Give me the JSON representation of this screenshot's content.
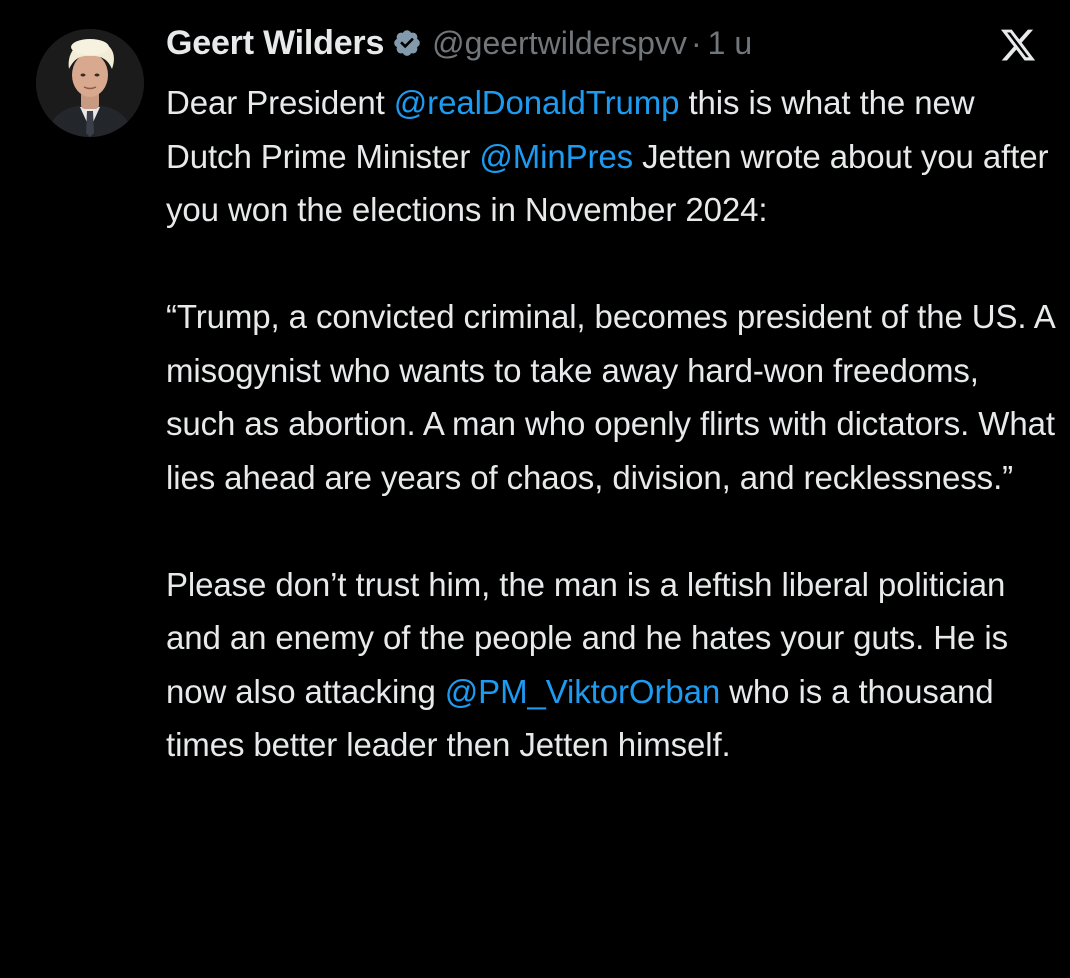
{
  "author": {
    "display_name": "Geert Wilders",
    "handle": "@geertwilderspvv",
    "separator": "·",
    "time": "1 u",
    "verified_icon": "verified-badge-icon",
    "avatar_icon": "profile-photo"
  },
  "brand": {
    "logo_icon": "x-logo-icon"
  },
  "colors": {
    "background": "#000000",
    "text": "#e7e9ea",
    "muted": "#71767b",
    "link": "#1d9bf0"
  },
  "tweet": {
    "p1_t1": "Dear President ",
    "p1_m1": "@realDonaldTrump",
    "p1_t2": " this is what the new Dutch Prime Minister ",
    "p1_m2": "@MinPres",
    "p1_t3": " Jetten wrote about you after you won the elections in November 2024:",
    "p2": "“Trump, a convicted criminal, becomes president of the US. A misogynist who wants to take away hard-won freedoms, such as abortion. A man who openly flirts with dictators. What lies ahead are years of chaos, division, and recklessness.”",
    "p3_t1": "Please don’t trust him, the man is a leftish liberal politician and an enemy of the people and he hates your guts. He is now also attacking ",
    "p3_m1": "@PM_ViktorOrban",
    "p3_t2": " who is a thousand times better leader then Jetten himself."
  }
}
